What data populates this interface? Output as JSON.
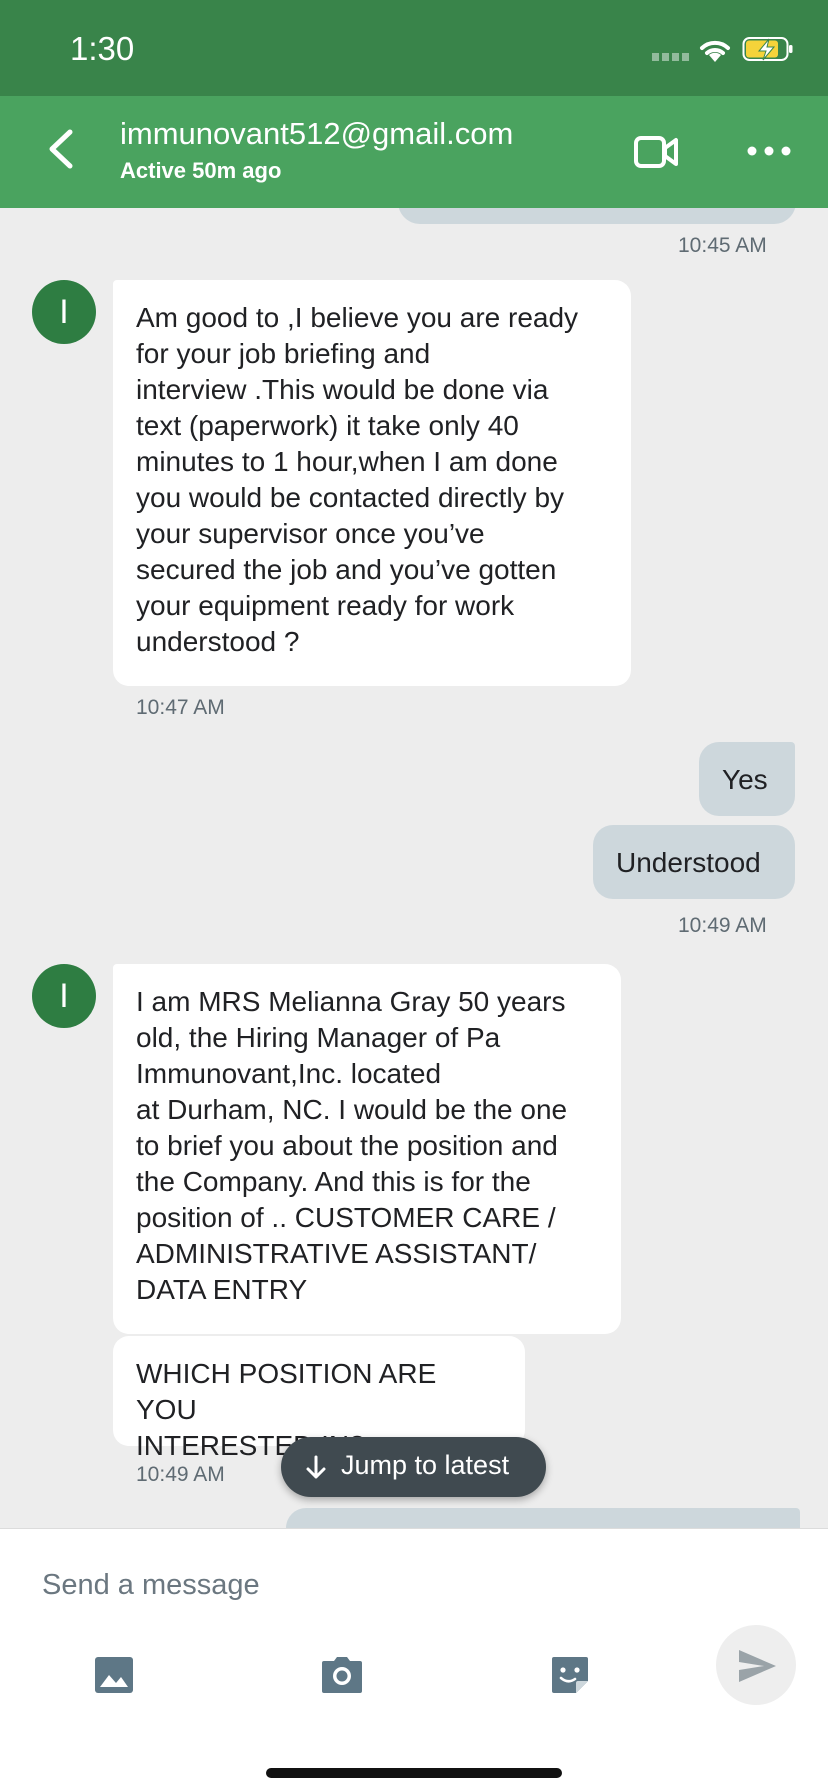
{
  "status_bar": {
    "time": "1:30"
  },
  "header": {
    "contact_name": "immunovant512@gmail.com",
    "contact_status": "Active 50m ago"
  },
  "messages": {
    "ts_1": "10:45 AM",
    "m1_avatar": "I",
    "m1_text": "Am good to  ,I believe you are ready\nfor your job briefing and\ninterview .This would be done via\ntext (paperwork) it take only 40\nminutes to 1 hour,when I am done\nyou would be contacted directly by\nyour supervisor once you’ve\nsecured the job and you’ve gotten\nyour equipment ready for work\nunderstood ?",
    "ts_2": "10:47 AM",
    "r1_text": "Yes",
    "r2_text": "Understood",
    "ts_3": "10:49 AM",
    "m2_avatar": "I",
    "m2_text": "I am MRS Melianna Gray   50 years\nold, the Hiring Manager of Pa\n Immunovant,Inc. located\nat Durham, NC. I would be the one\nto brief you about the position and\nthe Company. And this is for the\nposition of .. CUSTOMER CARE  /\nADMINISTRATIVE ASSISTANT/\nDATA ENTRY",
    "m3_text": "WHICH POSITION ARE YOU\nINTERESTED IN?",
    "ts_4": "10:49 AM"
  },
  "jump_to_latest": {
    "label": "Jump to latest"
  },
  "composer": {
    "placeholder": "Send a message"
  },
  "icons": {
    "back": "chevron-left-icon",
    "video": "video-camera-icon",
    "more": "more-horizontal-icon",
    "image": "image-icon",
    "camera": "camera-icon",
    "sticker": "sticker-icon",
    "send": "send-icon"
  },
  "colors": {
    "status_bar": "#39844a",
    "header": "#4aa35f",
    "avatar": "#2e7d42",
    "outgoing_bubble": "#cdd7dc",
    "chat_background": "#ededed"
  }
}
